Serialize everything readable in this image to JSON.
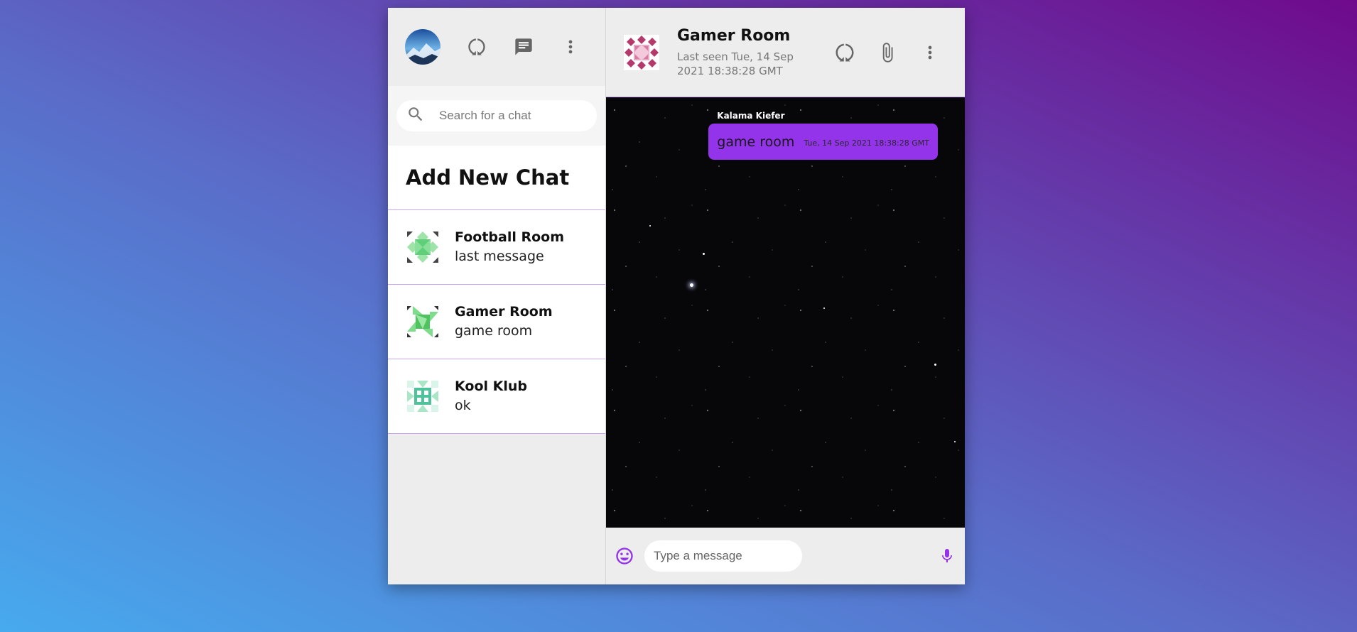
{
  "sidebar": {
    "search": {
      "placeholder": "Search for a chat",
      "value": ""
    },
    "add_chat_label": "Add New Chat",
    "chats": [
      {
        "name": "Football Room",
        "last_message": "last message"
      },
      {
        "name": "Gamer Room",
        "last_message": "game room"
      },
      {
        "name": "Kool Klub",
        "last_message": "ok"
      }
    ],
    "header_icons": [
      "status-icon",
      "chat-icon",
      "more-vert-icon"
    ]
  },
  "chat": {
    "header": {
      "title": "Gamer Room",
      "last_seen": "Last seen Tue, 14 Sep 2021 18:38:28 GMT",
      "icons": [
        "status-icon",
        "attach-icon",
        "more-vert-icon"
      ]
    },
    "messages": [
      {
        "sender": "Kalama Kiefer",
        "text": "game room",
        "time": "Tue, 14 Sep 2021 18:38:28 GMT"
      }
    ],
    "composer": {
      "placeholder": "Type a message",
      "value": ""
    }
  },
  "colors": {
    "accent": "#9333ea",
    "panel": "#ededed",
    "divider": "#c9a6ef",
    "icon_gray": "#666666"
  }
}
